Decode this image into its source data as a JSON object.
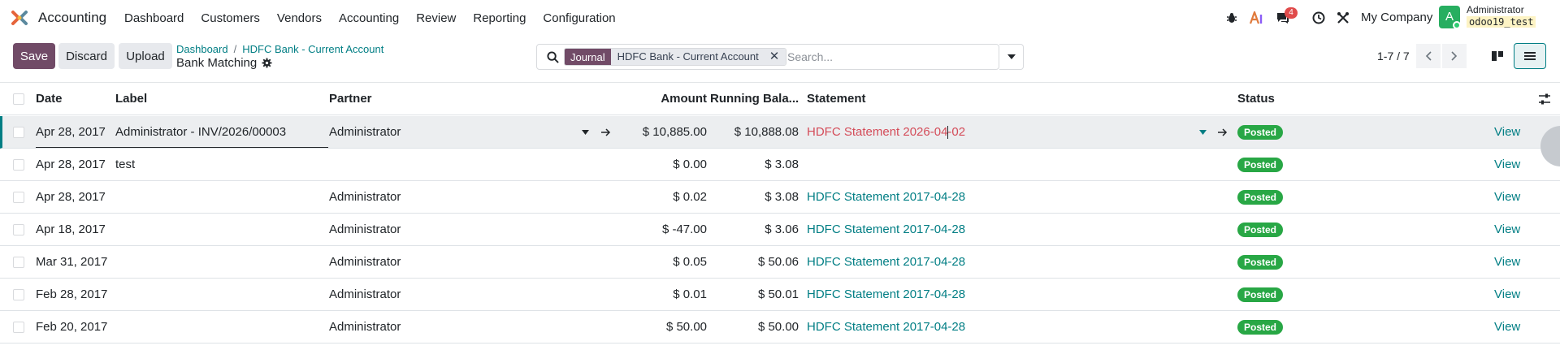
{
  "navbar": {
    "app_name": "Accounting",
    "menu": [
      "Dashboard",
      "Customers",
      "Vendors",
      "Accounting",
      "Review",
      "Reporting",
      "Configuration"
    ],
    "chat_count": "4",
    "company": "My Company",
    "avatar_initial": "A",
    "user_name": "Administrator",
    "database": "odoo19_test"
  },
  "control": {
    "save_label": "Save",
    "discard_label": "Discard",
    "upload_label": "Upload",
    "breadcrumb": [
      "Dashboard",
      "HDFC Bank - Current Account"
    ],
    "page_title": "Bank Matching",
    "search": {
      "facet_label": "Journal",
      "facet_value": "HDFC Bank - Current Account",
      "placeholder": "Search..."
    },
    "pager": "1-7 / 7"
  },
  "table": {
    "columns": {
      "date": "Date",
      "label": "Label",
      "partner": "Partner",
      "amount": "Amount",
      "running_balance": "Running Bala...",
      "statement": "Statement",
      "status": "Status"
    },
    "view_label": "View",
    "rows": [
      {
        "date": "Apr 28, 2017",
        "label": "Administrator - INV/2026/00003",
        "partner": "Administrator",
        "amount": "$ 10,885.00",
        "balance": "$ 10,888.08",
        "statement": "HDFC Statement 2026-04-02",
        "status": "Posted"
      },
      {
        "date": "Apr 28, 2017",
        "label": "test",
        "partner": "",
        "amount": "$ 0.00",
        "balance": "$ 3.08",
        "statement": "",
        "status": "Posted"
      },
      {
        "date": "Apr 28, 2017",
        "label": "",
        "partner": "Administrator",
        "amount": "$ 0.02",
        "balance": "$ 3.08",
        "statement": "HDFC Statement 2017-04-28",
        "status": "Posted"
      },
      {
        "date": "Apr 18, 2017",
        "label": "",
        "partner": "Administrator",
        "amount": "$ -47.00",
        "balance": "$ 3.06",
        "statement": "HDFC Statement 2017-04-28",
        "status": "Posted"
      },
      {
        "date": "Mar 31, 2017",
        "label": "",
        "partner": "Administrator",
        "amount": "$ 0.05",
        "balance": "$ 50.06",
        "statement": "HDFC Statement 2017-04-28",
        "status": "Posted"
      },
      {
        "date": "Feb 28, 2017",
        "label": "",
        "partner": "Administrator",
        "amount": "$ 0.01",
        "balance": "$ 50.01",
        "statement": "HDFC Statement 2017-04-28",
        "status": "Posted"
      },
      {
        "date": "Feb 20, 2017",
        "label": "",
        "partner": "Administrator",
        "amount": "$ 50.00",
        "balance": "$ 50.00",
        "statement": "HDFC Statement 2017-04-28",
        "status": "Posted"
      }
    ]
  },
  "colors": {
    "brand": "#714b67",
    "link": "#017e84",
    "success": "#28a745",
    "danger": "#d44c59"
  },
  "icons": [
    "accounting-logo-icon",
    "bug-icon",
    "ai-icon",
    "chat-icon",
    "clock-icon",
    "tools-icon",
    "search-icon",
    "close-icon",
    "caret-down-icon",
    "chevron-left-icon",
    "chevron-right-icon",
    "kanban-view-icon",
    "list-view-icon",
    "settings-adjust-icon",
    "arrow-right-icon",
    "gear-icon"
  ]
}
